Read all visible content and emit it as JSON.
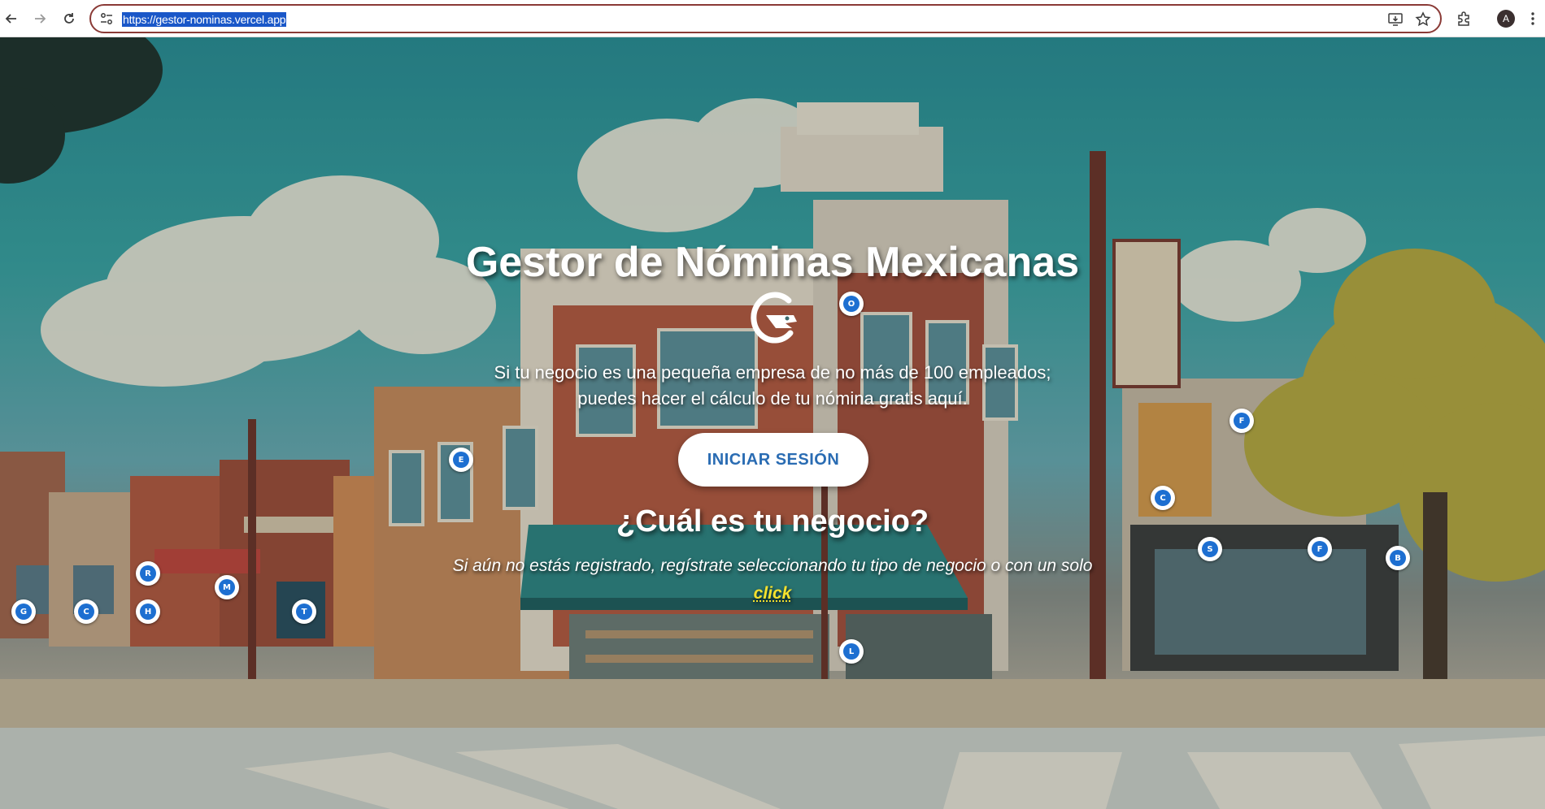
{
  "browser": {
    "url": "https://gestor-nominas.vercel.app"
  },
  "hero": {
    "title": "Gestor de Nóminas Mexicanas",
    "subtitle_line1": "Si tu negocio es una pequeña empresa de no más de 100 empleados;",
    "subtitle_line2": "puedes hacer el cálculo de tu nómina gratis aquí.",
    "login_button": "INICIAR SESIÓN",
    "question": "¿Cuál es tu negocio?",
    "register_text": "Si aún no estás registrado, regístrate seleccionando tu tipo de negocio o con un solo",
    "click_link": "click"
  },
  "markers": [
    {
      "letter": "O"
    },
    {
      "letter": "E"
    },
    {
      "letter": "F"
    },
    {
      "letter": "C"
    },
    {
      "letter": "S"
    },
    {
      "letter": "F"
    },
    {
      "letter": "B"
    },
    {
      "letter": "R"
    },
    {
      "letter": "M"
    },
    {
      "letter": "G"
    },
    {
      "letter": "C"
    },
    {
      "letter": "H"
    },
    {
      "letter": "T"
    },
    {
      "letter": "L"
    }
  ]
}
